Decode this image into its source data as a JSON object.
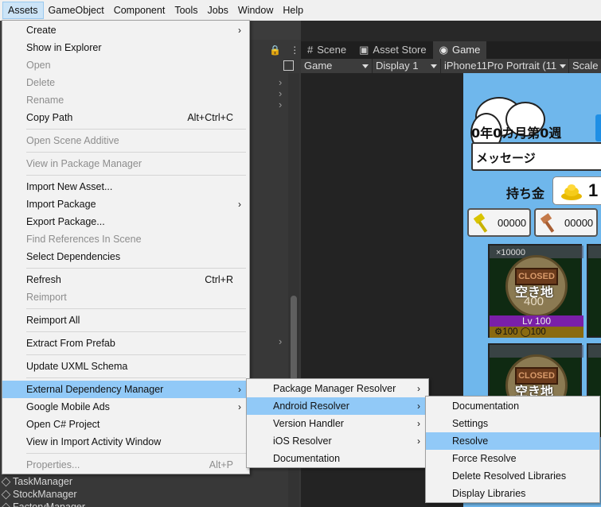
{
  "menubar": [
    "Assets",
    "GameObject",
    "Component",
    "Tools",
    "Jobs",
    "Window",
    "Help"
  ],
  "tabs": [
    {
      "label": "Scene",
      "icon": "grid-icon"
    },
    {
      "label": "Asset Store",
      "icon": "bag-icon"
    },
    {
      "label": "Game",
      "icon": "gamepad-icon"
    }
  ],
  "gamebar": {
    "mode": "Game",
    "display": "Display 1",
    "device": "iPhone11Pro Portrait (11",
    "scale": "Scale"
  },
  "hierarchy": [
    "TaskManager",
    "StockManager",
    "FactoryManager"
  ],
  "game": {
    "date": "0年0カ月第0週",
    "message": "メッセージ",
    "money_label": "持ち金",
    "money_value": "1",
    "tools": [
      {
        "count": "00000",
        "icon": "hammer-yellow-icon"
      },
      {
        "count": "00000",
        "icon": "hammer-brown-icon"
      }
    ],
    "plot": {
      "top": "×10000",
      "sign": "CLOSED",
      "status": "空き地",
      "value": "400",
      "level": "Lv 100",
      "bottom_left": "100",
      "bottom_right": "100"
    }
  },
  "assets_menu": [
    {
      "label": "Create",
      "submenu": true
    },
    {
      "label": "Show in Explorer"
    },
    {
      "label": "Open",
      "disabled": true
    },
    {
      "label": "Delete",
      "disabled": true
    },
    {
      "label": "Rename",
      "disabled": true
    },
    {
      "label": "Copy Path",
      "shortcut": "Alt+Ctrl+C"
    },
    {
      "separator": true
    },
    {
      "label": "Open Scene Additive",
      "disabled": true
    },
    {
      "separator": true
    },
    {
      "label": "View in Package Manager",
      "disabled": true
    },
    {
      "separator": true
    },
    {
      "label": "Import New Asset..."
    },
    {
      "label": "Import Package",
      "submenu": true
    },
    {
      "label": "Export Package..."
    },
    {
      "label": "Find References In Scene",
      "disabled": true
    },
    {
      "label": "Select Dependencies"
    },
    {
      "separator": true
    },
    {
      "label": "Refresh",
      "shortcut": "Ctrl+R"
    },
    {
      "label": "Reimport",
      "disabled": true
    },
    {
      "separator": true
    },
    {
      "label": "Reimport All"
    },
    {
      "separator": true
    },
    {
      "label": "Extract From Prefab"
    },
    {
      "separator": true
    },
    {
      "label": "Update UXML Schema"
    },
    {
      "separator": true
    },
    {
      "label": "External Dependency Manager",
      "submenu": true,
      "highlight": true
    },
    {
      "label": "Google Mobile Ads",
      "submenu": true
    },
    {
      "label": "Open C# Project"
    },
    {
      "label": "View in Import Activity Window"
    },
    {
      "separator": true
    },
    {
      "label": "Properties...",
      "shortcut": "Alt+P",
      "disabled": true
    }
  ],
  "edm_menu": [
    {
      "label": "Package Manager Resolver",
      "submenu": true
    },
    {
      "label": "Android Resolver",
      "submenu": true,
      "highlight": true
    },
    {
      "label": "Version Handler",
      "submenu": true
    },
    {
      "label": "iOS Resolver",
      "submenu": true
    },
    {
      "label": "Documentation"
    }
  ],
  "android_menu": [
    {
      "label": "Documentation"
    },
    {
      "label": "Settings"
    },
    {
      "label": "Resolve",
      "highlight": true
    },
    {
      "label": "Force Resolve"
    },
    {
      "label": "Delete Resolved Libraries"
    },
    {
      "label": "Display Libraries"
    }
  ],
  "colors": {
    "highlight": "#91c9f7",
    "menu_bg": "#f2f2f2",
    "game_bg": "#6fb7ec"
  }
}
